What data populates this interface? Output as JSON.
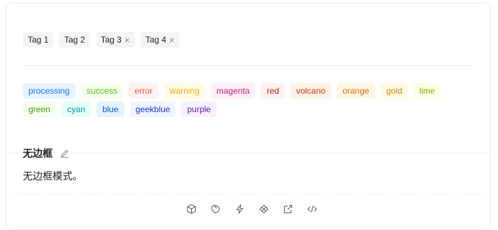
{
  "basic_tags": [
    {
      "label": "Tag 1",
      "closable": false
    },
    {
      "label": "Tag 2",
      "closable": false
    },
    {
      "label": "Tag 3",
      "closable": true
    },
    {
      "label": "Tag 4",
      "closable": true
    }
  ],
  "close_glyph": "×",
  "color_tags": [
    {
      "label": "processing",
      "color": "#1677ff",
      "bg": "#e6f4ff"
    },
    {
      "label": "success",
      "color": "#52c41a",
      "bg": "#f6ffed"
    },
    {
      "label": "error",
      "color": "#ff4d4f",
      "bg": "#fff2f0"
    },
    {
      "label": "warning",
      "color": "#faad14",
      "bg": "#fffbe6"
    },
    {
      "label": "magenta",
      "color": "#c41d7f",
      "bg": "#fff0f6"
    },
    {
      "label": "red",
      "color": "#cf1322",
      "bg": "#fff1f0"
    },
    {
      "label": "volcano",
      "color": "#d4380d",
      "bg": "#fff2e8"
    },
    {
      "label": "orange",
      "color": "#d46b08",
      "bg": "#fff7e6"
    },
    {
      "label": "gold",
      "color": "#d48806",
      "bg": "#fffbe6"
    },
    {
      "label": "lime",
      "color": "#7cb305",
      "bg": "#fcffe6"
    },
    {
      "label": "green",
      "color": "#389e0d",
      "bg": "#f6ffed"
    },
    {
      "label": "cyan",
      "color": "#08979c",
      "bg": "#e6fffb"
    },
    {
      "label": "blue",
      "color": "#0958d9",
      "bg": "#e6f4ff"
    },
    {
      "label": "geekblue",
      "color": "#1d39c4",
      "bg": "#f0f5ff"
    },
    {
      "label": "purple",
      "color": "#531dab",
      "bg": "#f9f0ff"
    }
  ],
  "demo": {
    "title": "无边框",
    "description": "无边框模式。"
  },
  "actions": [
    {
      "name": "codesandbox-icon"
    },
    {
      "name": "codepen-icon"
    },
    {
      "name": "stackblitz-icon"
    },
    {
      "name": "riddle-icon"
    },
    {
      "name": "open-external-icon"
    },
    {
      "name": "show-code-icon"
    }
  ]
}
